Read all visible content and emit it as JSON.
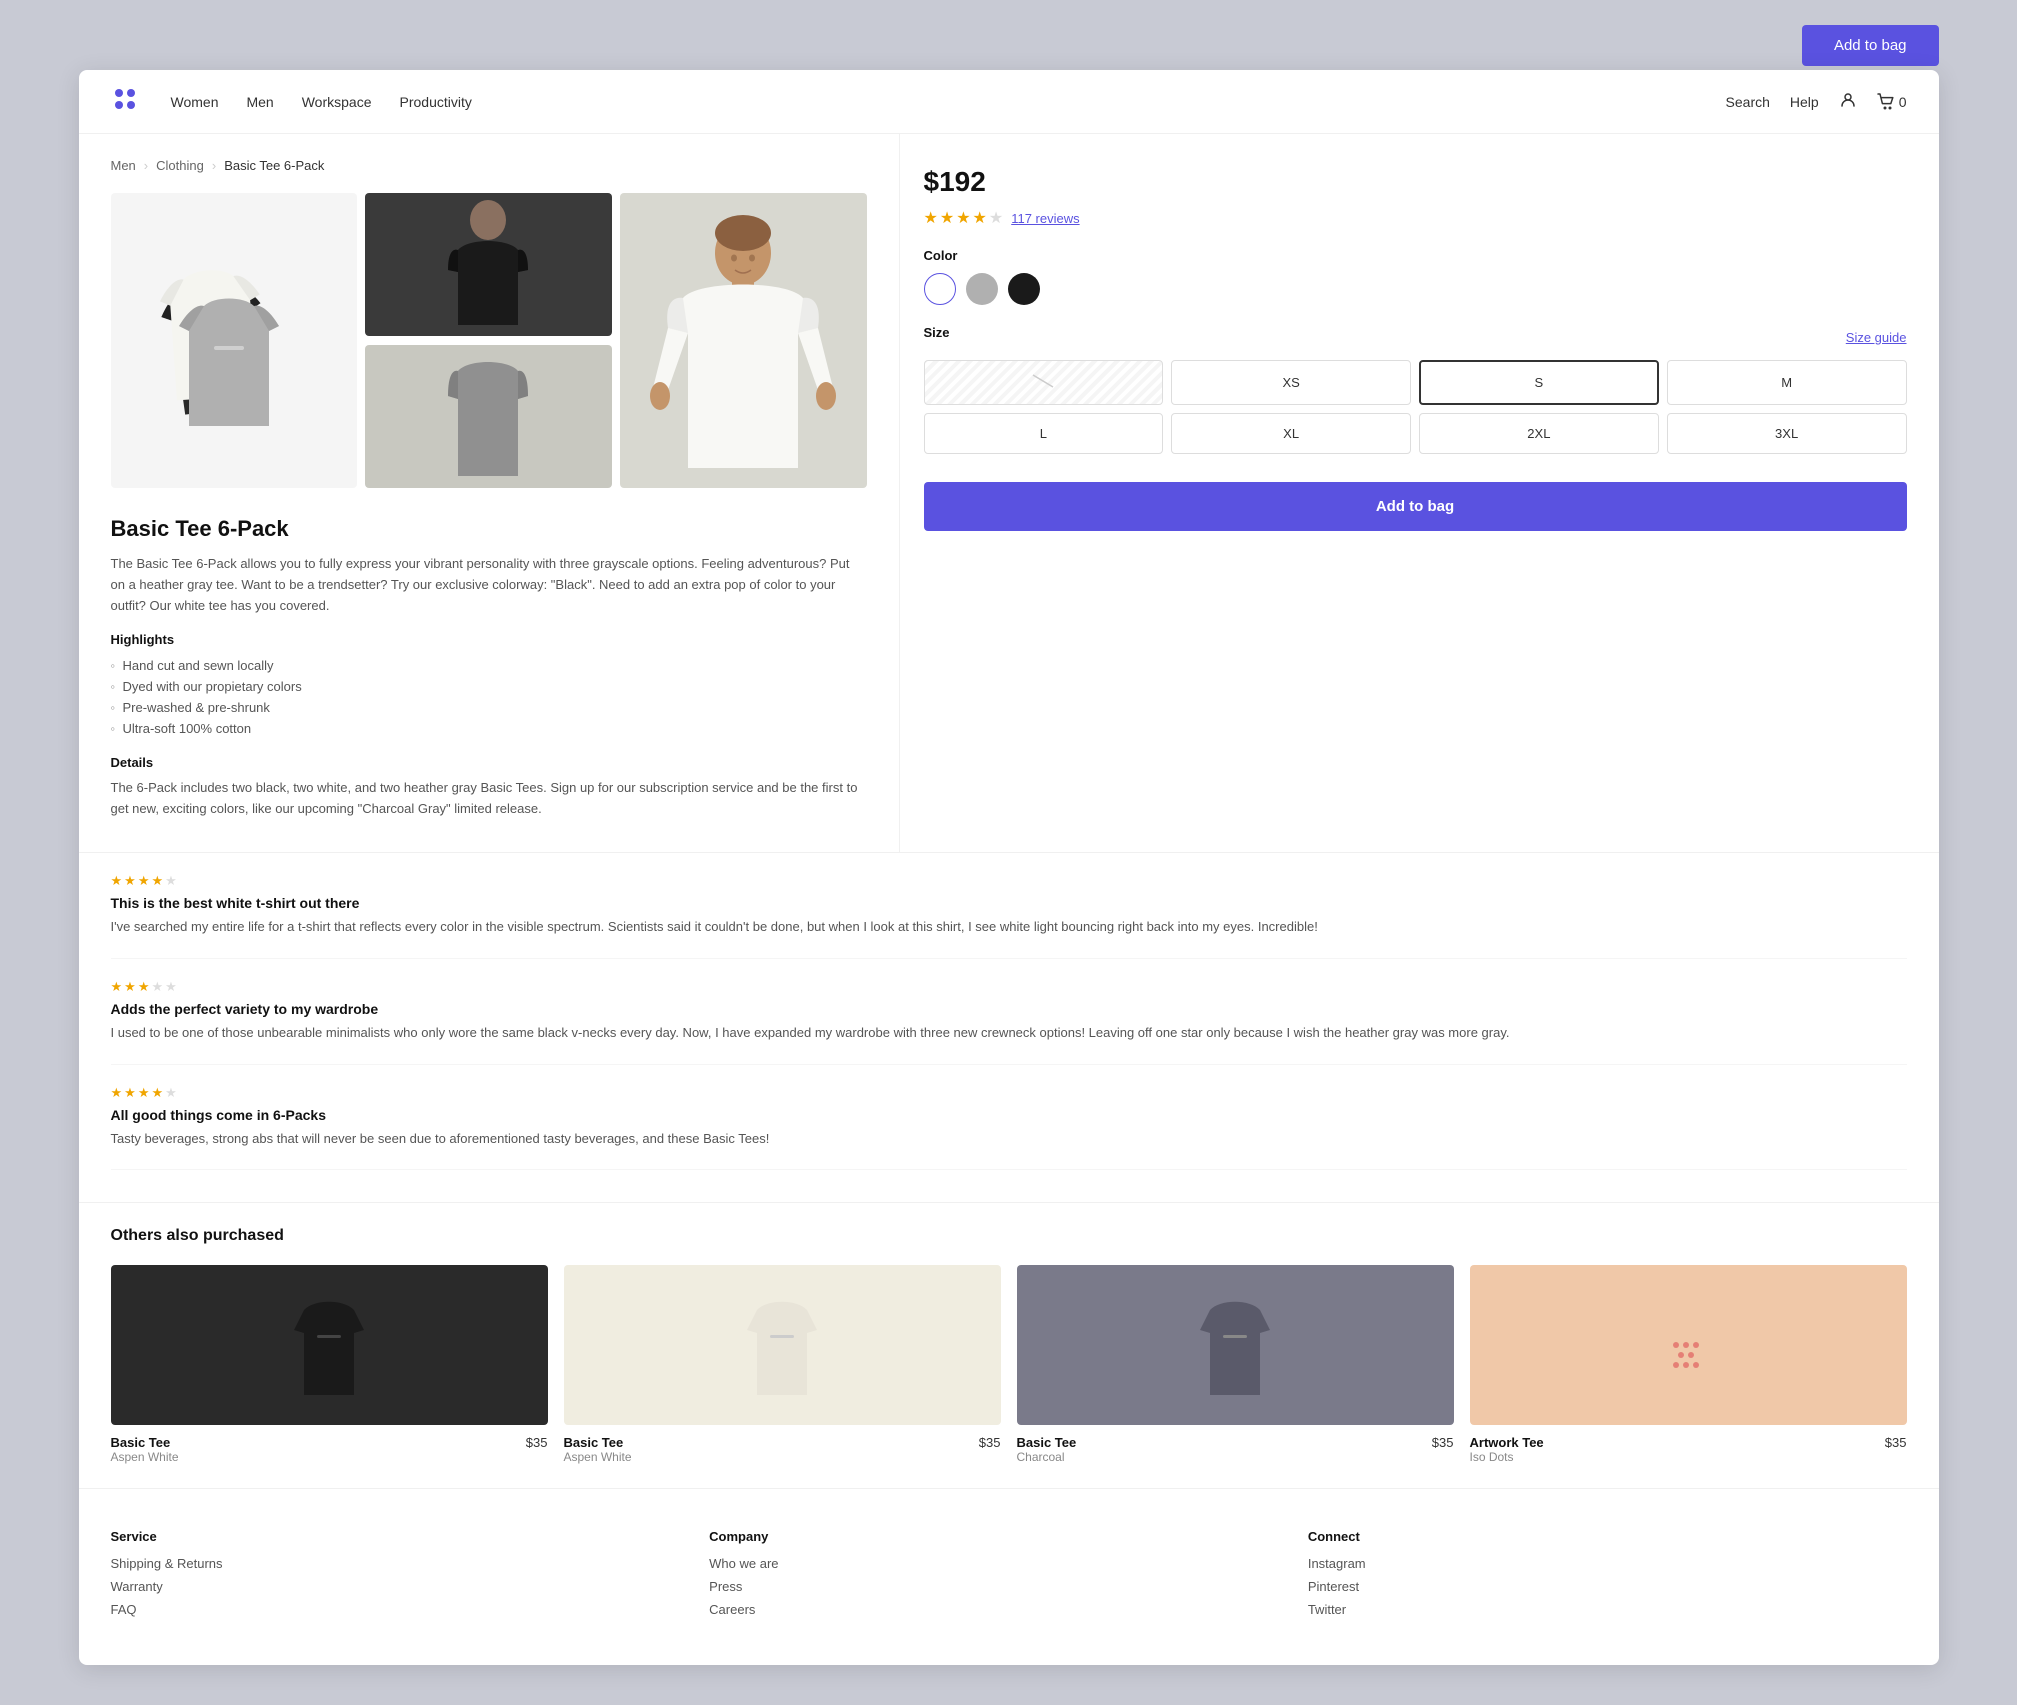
{
  "page": {
    "title": "Basic Tee 6-Pack"
  },
  "header": {
    "logo_alt": "Store logo",
    "nav": [
      "Women",
      "Men",
      "Workspace",
      "Productivity"
    ],
    "search_label": "Search",
    "help_label": "Help",
    "cart_count": "0"
  },
  "breadcrumb": {
    "men": "Men",
    "clothing": "Clothing",
    "product": "Basic Tee 6-Pack"
  },
  "product": {
    "title": "Basic Tee 6-Pack",
    "price": "$192",
    "rating": 4,
    "max_rating": 5,
    "review_count": "117 reviews",
    "description": "The Basic Tee 6-Pack allows you to fully express your vibrant personality with three grayscale options. Feeling adventurous? Put on a heather gray tee. Want to be a trendsetter? Try our exclusive colorway: \"Black\". Need to add an extra pop of color to your outfit? Our white tee has you covered.",
    "highlights_title": "Highlights",
    "highlights": [
      "Hand cut and sewn locally",
      "Dyed with our propietary colors",
      "Pre-washed & pre-shrunk",
      "Ultra-soft 100% cotton"
    ],
    "details_title": "Details",
    "details_text": "The 6-Pack includes two black, two white, and two heather gray Basic Tees. Sign up for our subscription service and be the first to get new, exciting colors, like our upcoming \"Charcoal Gray\" limited release.",
    "color_label": "Color",
    "size_label": "Size",
    "size_guide": "Size guide",
    "colors": [
      {
        "name": "White",
        "class": "color-white"
      },
      {
        "name": "Gray",
        "class": "color-gray"
      },
      {
        "name": "Black",
        "class": "color-black"
      }
    ],
    "sizes": [
      "XS",
      "S",
      "M",
      "L",
      "XL",
      "2XL",
      "3XL"
    ],
    "selected_size": "S",
    "add_to_bag_label": "Add to bag"
  },
  "reviews": [
    {
      "title": "This is the best white t-shirt out there",
      "stars": 4,
      "text": "I've searched my entire life for a t-shirt that reflects every color in the visible spectrum. Scientists said it couldn't be done, but when I look at this shirt, I see white light bouncing right back into my eyes. Incredible!"
    },
    {
      "title": "Adds the perfect variety to my wardrobe",
      "stars": 3,
      "text": "I used to be one of those unbearable minimalists who only wore the same black v-necks every day. Now, I have expanded my wardrobe with three new crewneck options! Leaving off one star only because I wish the heather gray was more gray."
    },
    {
      "title": "All good things come in 6-Packs",
      "stars": 4,
      "text": "Tasty beverages, strong abs that will never be seen due to aforementioned tasty beverages, and these Basic Tees!"
    }
  ],
  "also_purchased": {
    "heading": "Others also purchased",
    "products": [
      {
        "name": "Basic Tee",
        "variant": "Aspen White",
        "price": "$35",
        "color": "#1a1a1a"
      },
      {
        "name": "Basic Tee",
        "variant": "Aspen White",
        "price": "$35",
        "color": "#e8e4d8"
      },
      {
        "name": "Basic Tee",
        "variant": "Charcoal",
        "price": "$35",
        "color": "#5a5a6a"
      },
      {
        "name": "Artwork Tee",
        "variant": "Iso Dots",
        "price": "$35",
        "color": "#f0c8a8"
      }
    ]
  },
  "footer": {
    "columns": [
      {
        "title": "Service",
        "links": [
          "Shipping & Returns",
          "Warranty",
          "FAQ"
        ]
      },
      {
        "title": "Company",
        "links": [
          "Who we are",
          "Press",
          "Careers"
        ]
      },
      {
        "title": "Connect",
        "links": [
          "Instagram",
          "Pinterest",
          "Twitter"
        ]
      }
    ]
  }
}
